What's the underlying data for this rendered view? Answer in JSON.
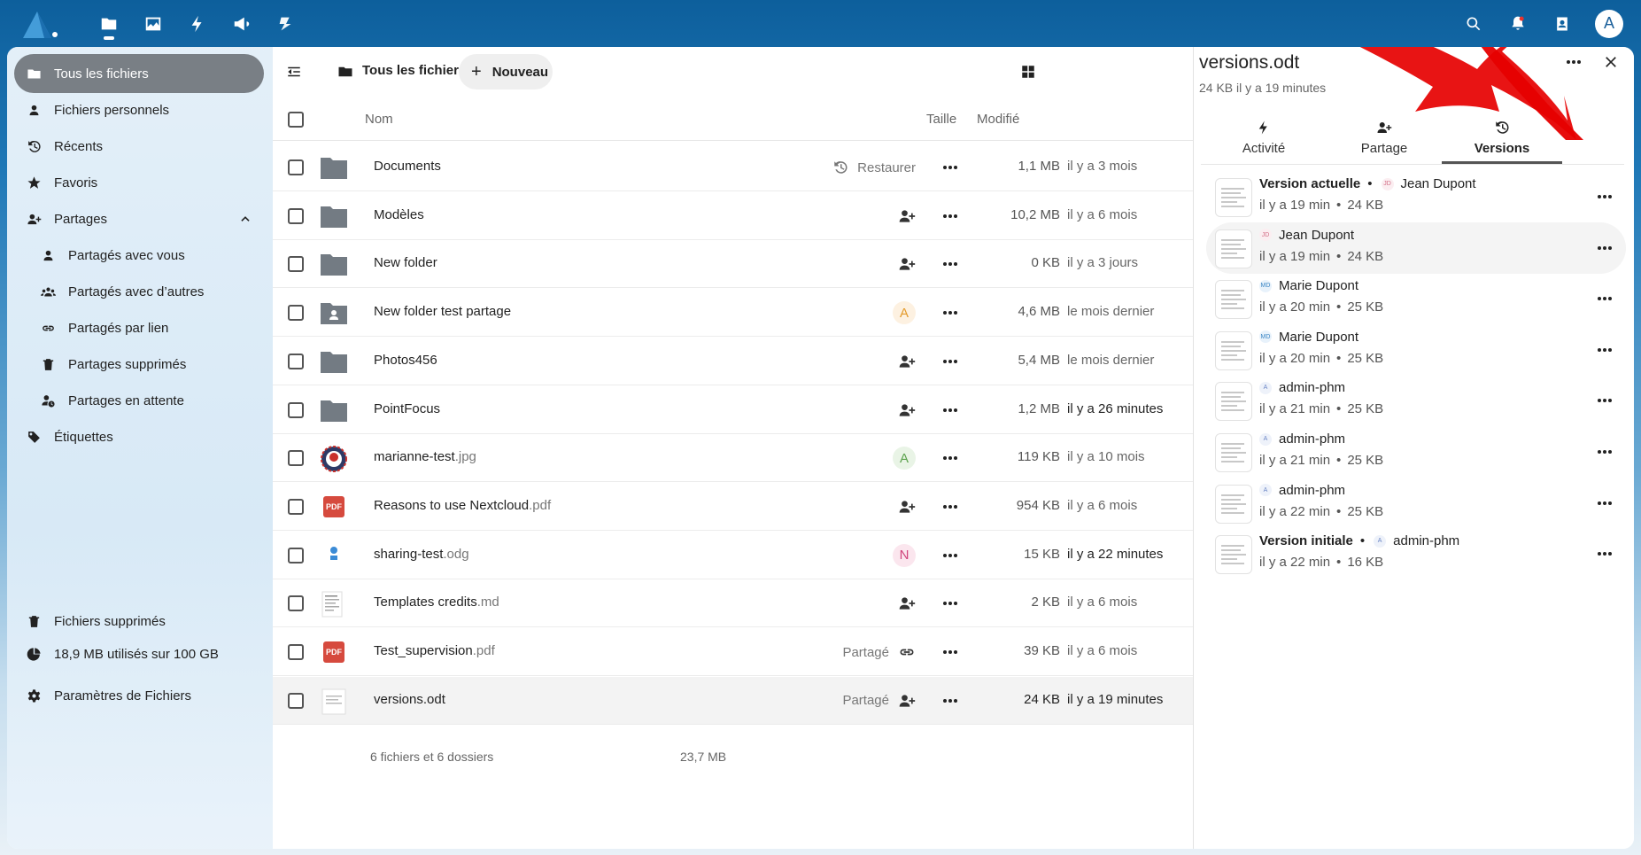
{
  "topbar": {
    "apps": [
      "files-icon",
      "photos-icon",
      "activity-icon",
      "announcements-icon",
      "deck-icon"
    ],
    "avatar_initial": "A"
  },
  "nav": {
    "items": [
      {
        "label": "Tous les fichiers",
        "icon": "folder-icon"
      },
      {
        "label": "Fichiers personnels",
        "icon": "user-icon"
      },
      {
        "label": "Récents",
        "icon": "history-icon"
      },
      {
        "label": "Favoris",
        "icon": "star-icon"
      },
      {
        "label": "Partages",
        "icon": "share-icon"
      },
      {
        "label": "Partagés avec vous",
        "icon": "user-icon"
      },
      {
        "label": "Partagés avec d’autres",
        "icon": "group-icon"
      },
      {
        "label": "Partagés par lien",
        "icon": "link-icon"
      },
      {
        "label": "Partages supprimés",
        "icon": "trash-icon"
      },
      {
        "label": "Partages en attente",
        "icon": "pending-icon"
      },
      {
        "label": "Étiquettes",
        "icon": "tag-icon"
      }
    ],
    "trash": "Fichiers supprimés",
    "quota": "18,9 MB utilisés sur 100 GB",
    "settings": "Paramètres de Fichiers"
  },
  "main": {
    "breadcrumb": "Tous les fichiers",
    "new_button": "Nouveau",
    "columns": {
      "name": "Nom",
      "size": "Taille",
      "modified": "Modifié"
    },
    "rows": [
      {
        "name": "Documents",
        "ext": "",
        "type": "folder",
        "action": "Restaurer",
        "action_kind": "restore",
        "size": "1,1 MB",
        "modified": "il y a 3 mois"
      },
      {
        "name": "Modèles",
        "ext": "",
        "type": "folder",
        "action": "",
        "action_kind": "share",
        "size": "10,2 MB",
        "modified": "il y a 6 mois"
      },
      {
        "name": "New folder",
        "ext": "",
        "type": "folder",
        "action": "",
        "action_kind": "share",
        "size": "0 KB",
        "modified": "il y a 3 jours"
      },
      {
        "name": "New folder test partage",
        "ext": "",
        "type": "shared-folder",
        "action": "A",
        "action_kind": "avatar-a-orange",
        "size": "4,6 MB",
        "modified": "le mois dernier"
      },
      {
        "name": "Photos456",
        "ext": "",
        "type": "folder",
        "action": "",
        "action_kind": "share",
        "size": "5,4 MB",
        "modified": "le mois dernier"
      },
      {
        "name": "PointFocus",
        "ext": "",
        "type": "folder",
        "action": "",
        "action_kind": "share",
        "size": "1,2 MB",
        "modified": "il y a 26 minutes"
      },
      {
        "name": "marianne-test",
        "ext": ".jpg",
        "type": "image",
        "action": "A",
        "action_kind": "avatar-a-green",
        "size": "119 KB",
        "modified": "il y a 10 mois"
      },
      {
        "name": "Reasons to use Nextcloud",
        "ext": ".pdf",
        "type": "pdf",
        "action": "",
        "action_kind": "share",
        "size": "954 KB",
        "modified": "il y a 6 mois"
      },
      {
        "name": "sharing-test",
        "ext": ".odg",
        "type": "drawing",
        "action": "N",
        "action_kind": "avatar-n-pink",
        "size": "15 KB",
        "modified": "il y a 22 minutes"
      },
      {
        "name": "Templates credits",
        "ext": ".md",
        "type": "text",
        "action": "",
        "action_kind": "share",
        "size": "2 KB",
        "modified": "il y a 6 mois"
      },
      {
        "name": "Test_supervision",
        "ext": ".pdf",
        "type": "pdf",
        "action": "Partagé",
        "action_kind": "link",
        "size": "39 KB",
        "modified": "il y a 6 mois"
      },
      {
        "name": "versions.odt",
        "ext": "",
        "type": "doc",
        "action": "Partagé",
        "action_kind": "share",
        "size": "24 KB",
        "modified": "il y a 19 minutes"
      }
    ],
    "summary": "6 fichiers et 6 dossiers",
    "summary_size": "23,7 MB",
    "pdf_badge": "PDF"
  },
  "sidebar": {
    "title": "versions.odt",
    "subtitle": "24 KB il y a 19 minutes",
    "tabs": [
      "Activité",
      "Partage",
      "Versions"
    ],
    "active_tab": "Versions",
    "versions": [
      {
        "label": "Version actuelle",
        "bullet": "•",
        "initials": "JD",
        "author": "Jean Dupont",
        "time": "il y a 19 min",
        "size": "24 KB"
      },
      {
        "label": "",
        "bullet": "",
        "initials": "JD",
        "author": "Jean Dupont",
        "time": "il y a 19 min",
        "size": "24 KB"
      },
      {
        "label": "",
        "bullet": "",
        "initials": "MD",
        "author": "Marie Dupont",
        "time": "il y a 20 min",
        "size": "25 KB"
      },
      {
        "label": "",
        "bullet": "",
        "initials": "MD",
        "author": "Marie Dupont",
        "time": "il y a 20 min",
        "size": "25 KB"
      },
      {
        "label": "",
        "bullet": "",
        "initials": "A",
        "author": "admin-phm",
        "time": "il y a 21 min",
        "size": "25 KB"
      },
      {
        "label": "",
        "bullet": "",
        "initials": "A",
        "author": "admin-phm",
        "time": "il y a 21 min",
        "size": "25 KB"
      },
      {
        "label": "",
        "bullet": "",
        "initials": "A",
        "author": "admin-phm",
        "time": "il y a 22 min",
        "size": "25 KB"
      },
      {
        "label": "Version initiale",
        "bullet": "•",
        "initials": "A",
        "author": "admin-phm",
        "time": "il y a 22 min",
        "size": "16 KB"
      }
    ],
    "sep": "•"
  },
  "colors": {
    "header": "#0d5f9c",
    "active_nav": "#797f85",
    "annotation_arrow": "#e60000"
  }
}
